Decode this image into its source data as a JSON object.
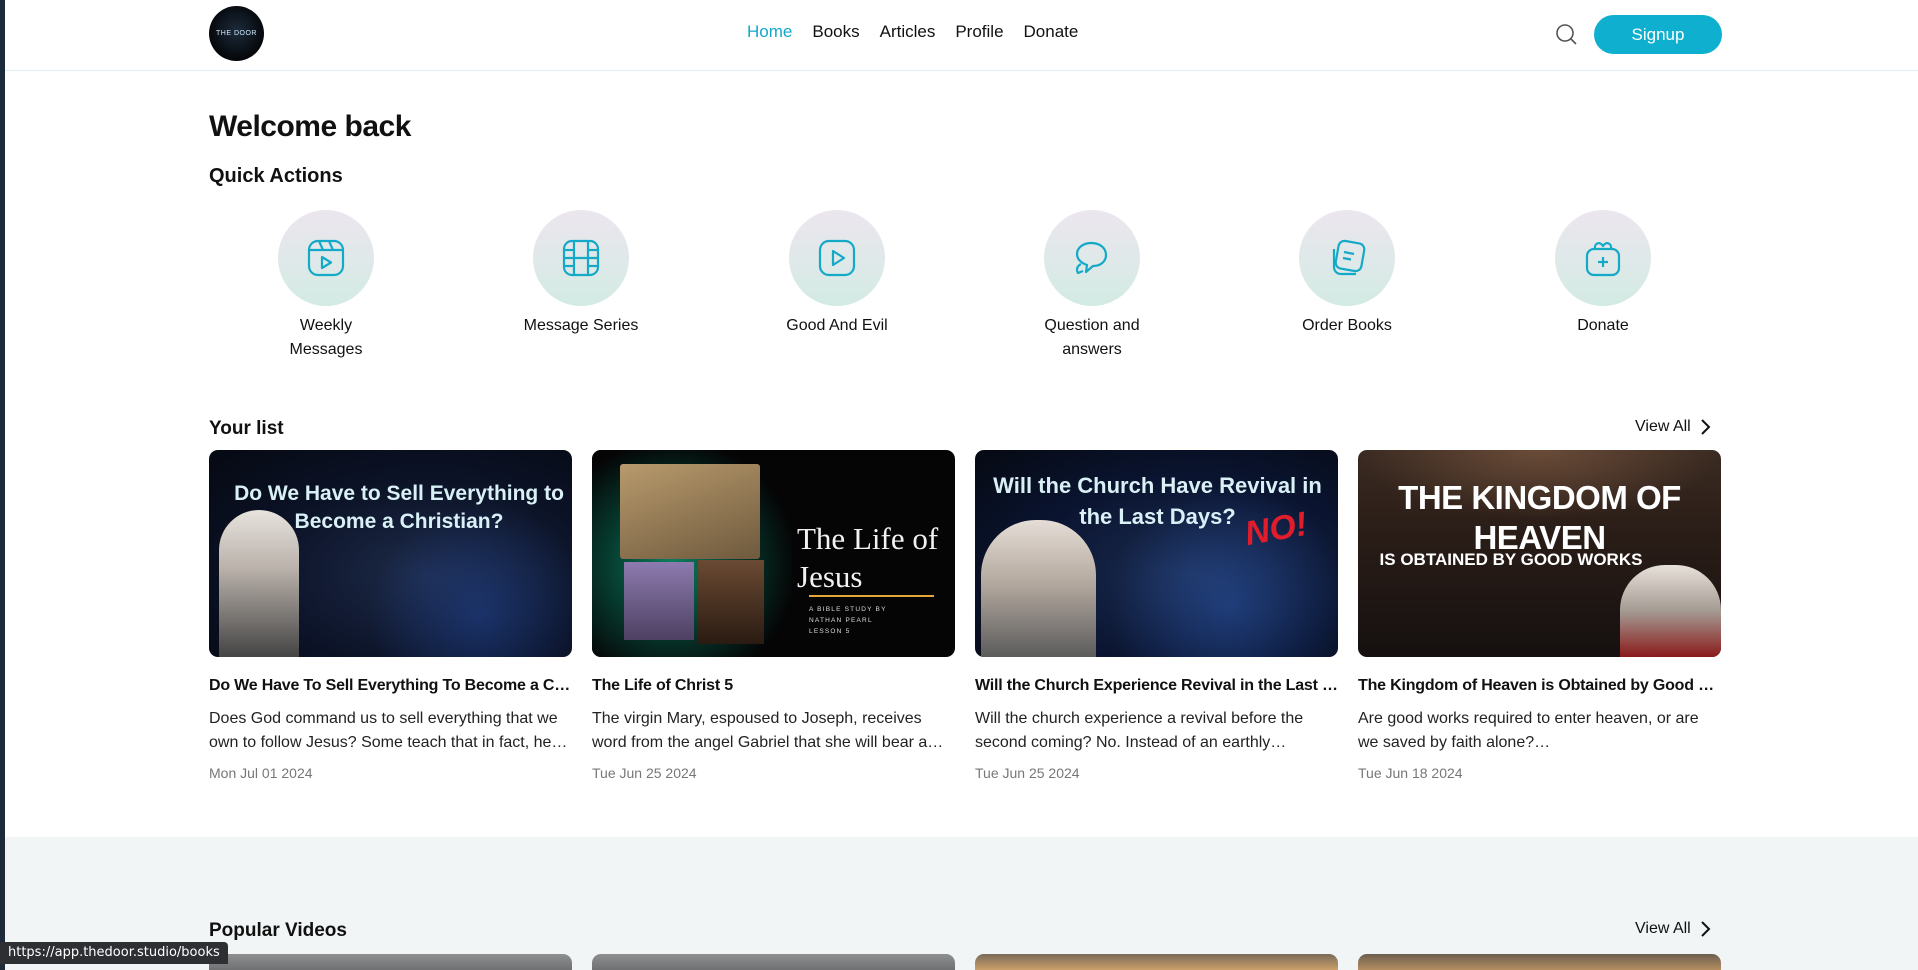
{
  "header": {
    "logo_text": "THE DOOR",
    "nav": [
      "Home",
      "Books",
      "Articles",
      "Profile",
      "Donate"
    ],
    "active_nav": "Home",
    "signup_label": "Signup"
  },
  "main": {
    "welcome": "Welcome back",
    "quick_actions_title": "Quick Actions",
    "quick_actions": [
      {
        "label": "Weekly Messages",
        "icon": "video-reel-icon"
      },
      {
        "label": "Message Series",
        "icon": "film-strip-icon"
      },
      {
        "label": "Good And Evil",
        "icon": "play-square-icon"
      },
      {
        "label": "Question and answers",
        "icon": "chat-bubbles-icon"
      },
      {
        "label": "Order Books",
        "icon": "book-stack-icon"
      },
      {
        "label": "Donate",
        "icon": "gift-bag-icon"
      }
    ],
    "your_list": {
      "title": "Your list",
      "view_all": "View All",
      "items": [
        {
          "thumb_text": "Do We Have to Sell Everything to Become a Christian?",
          "title": "Do We Have To Sell Everything To Become a Christian?",
          "description": "Does God command us to sell everything that we own to follow Jesus? Some teach that in fact, he does.",
          "date": "Mon Jul 01 2024"
        },
        {
          "thumb_text": "The Life of Jesus",
          "thumb_sub": "A BIBLE STUDY BY NATHAN PEARL LESSON 5",
          "title": "The Life of Christ 5",
          "description": "The virgin Mary, espoused to Joseph, receives word from the angel Gabriel that she will bear a son. This is the story.",
          "date": "Tue Jun 25 2024"
        },
        {
          "thumb_text": "Will the Church Have Revival in the Last Days?",
          "thumb_extra": "NO!",
          "title": "Will the Church Experience Revival in the Last Days?",
          "description": "Will the church experience a revival before the second coming? No. Instead of an earthly kingdom, there will be a falling away.",
          "date": "Tue Jun 25 2024"
        },
        {
          "thumb_text": "THE KINGDOM OF HEAVEN",
          "thumb_sub": "IS OBTAINED BY GOOD WORKS",
          "title": "The Kingdom of Heaven is Obtained by Good Works?",
          "description": "Are good works required to enter heaven, or are we saved by faith alone?…",
          "date": "Tue Jun 18 2024"
        }
      ]
    },
    "popular_videos": {
      "title": "Popular Videos",
      "view_all": "View All"
    }
  },
  "status_bar": {
    "url": "https://app.thedoor.studio/books"
  },
  "colors": {
    "accent": "#0fb0cf",
    "nav_active": "#13a8c9"
  }
}
